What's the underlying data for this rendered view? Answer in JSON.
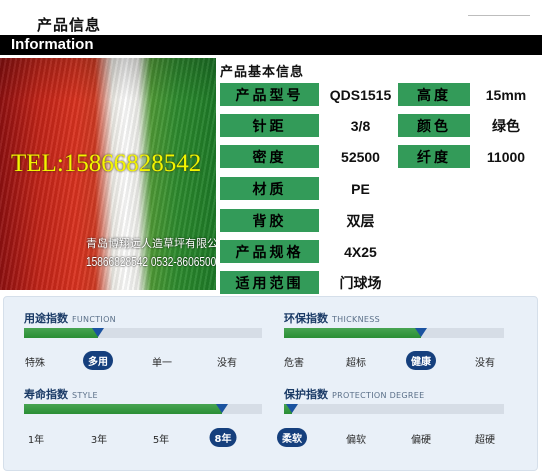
{
  "header": {
    "page_title": "产品信息",
    "banner": "Information"
  },
  "photo": {
    "tel": "TEL:15866828542",
    "company": "青岛博翔远人造草坪有限公司",
    "phones": "15866828542 0532-86065009"
  },
  "spec": {
    "heading": "产品基本信息",
    "rows": [
      {
        "l1": "产品型号",
        "v1": "QDS1515",
        "l2": "高度",
        "v2": "15mm"
      },
      {
        "l1": "针距",
        "v1": "3/8",
        "l2": "颜色",
        "v2": "绿色"
      },
      {
        "l1": "密度",
        "v1": "52500",
        "l2": "纤度",
        "v2": "11000"
      },
      {
        "l1": "材质",
        "v1": "PE"
      },
      {
        "l1": "背胶",
        "v1": "双层"
      },
      {
        "l1": "产品规格",
        "v1": "4X25"
      },
      {
        "l1": "适用范围",
        "v1": "门球场"
      }
    ]
  },
  "indices": {
    "usage": {
      "title": "用途指数",
      "subtitle": "FUNCTION",
      "ticks": [
        "特殊",
        "多用",
        "单一",
        "没有"
      ],
      "selected": 1
    },
    "eco": {
      "title": "环保指数",
      "subtitle": "THICKNESS",
      "ticks": [
        "危害",
        "超标",
        "健康",
        "没有"
      ],
      "selected": 2
    },
    "life": {
      "title": "寿命指数",
      "subtitle": "STYLE",
      "ticks": [
        "1年",
        "3年",
        "5年",
        "8年"
      ],
      "selected": 3
    },
    "protect": {
      "title": "保护指数",
      "subtitle": "PROTECTION DEGREE",
      "ticks": [
        "柔软",
        "偏软",
        "偏硬",
        "超硬"
      ],
      "selected": 0
    }
  },
  "colors": {
    "label_green": "#339b59",
    "bar_green": "#2a8e35",
    "marker_blue": "#1b53a0",
    "pill_blue": "#153f7d",
    "panel_bg": "#e9f0f8"
  }
}
